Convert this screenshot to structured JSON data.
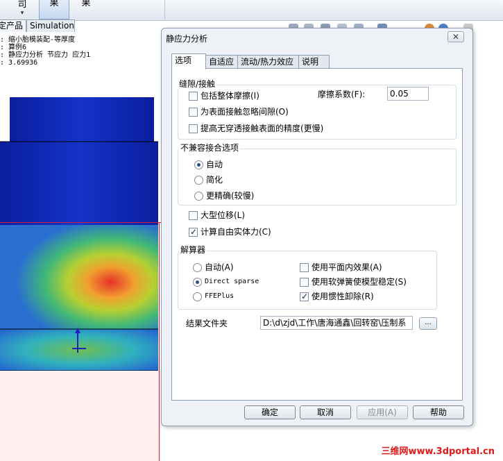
{
  "toolbar": {
    "btn1_label": "司",
    "btn2_label": "果",
    "btn3_label": "果"
  },
  "cm_tabs": [
    "定产品",
    "Simulation"
  ],
  "tree_lines": [
    ": 缩小胎模装配-等厚度",
    ": 算例6",
    ": 静应力分析 节应力 应力1",
    ": 3.69936"
  ],
  "watermark": "三维网www.3dportal.cn",
  "dialog": {
    "title": "静应力分析",
    "close_symbol": "✕",
    "tabs": [
      "选项",
      "自适应",
      "流动/热力效应",
      "说明"
    ],
    "contact_group": {
      "title": "缝隙/接触",
      "include_friction": "包括整体摩擦(I)",
      "friction_label": "摩擦系数(F):",
      "friction_value": "0.05",
      "ignore_clearance": "为表面接触忽略间隙(O)",
      "improve_accuracy": "提高无穿透接触表面的精度(更慢)"
    },
    "bonding_group": {
      "title": "不兼容接合选项",
      "auto": "自动",
      "simplified": "简化",
      "more_accurate": "更精确(较慢)"
    },
    "large_displacement": "大型位移(L)",
    "free_body_forces": "计算自由实体力(C)",
    "solver_group": {
      "title": "解算器",
      "auto": "自动(A)",
      "direct_sparse": "Direct sparse",
      "ffeplus": "FFEPlus",
      "inplane_effect": "使用平面内效果(A)",
      "soft_spring": "使用软弹簧使模型稳定(S)",
      "inertial_relief": "使用惯性卸除(R)"
    },
    "results_folder_label": "结果文件夹",
    "results_folder_value": "D:\\d\\zjd\\工作\\唐海通鑫\\回转窑\\压制系",
    "browse_label": "...",
    "buttons": {
      "ok": "确定",
      "cancel": "取消",
      "apply": "应用(A)",
      "help": "帮助"
    }
  }
}
